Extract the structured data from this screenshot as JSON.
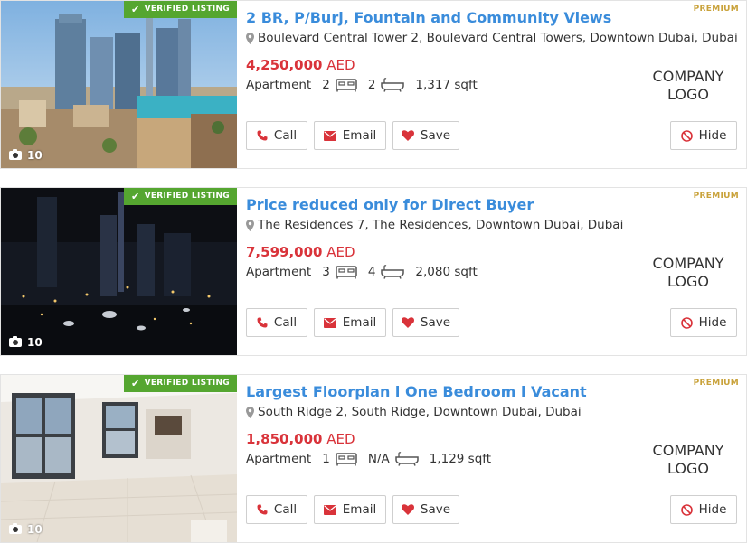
{
  "listings": [
    {
      "verified_label": "VERIFIED LISTING",
      "photo_count": "10",
      "title": "2 BR, P/Burj, Fountain and Community Views",
      "premium_label": "PREMIUM",
      "address": "Boulevard Central Tower 2, Boulevard Central Towers, Downtown Dubai, Dubai",
      "price_amount": "4,250,000",
      "price_currency": "AED",
      "property_type": "Apartment",
      "bedrooms": "2",
      "bathrooms": "2",
      "area": "1,317 sqft",
      "logo_line1": "COMPANY",
      "logo_line2": "LOGO",
      "buttons": {
        "call": "Call",
        "email": "Email",
        "save": "Save",
        "hide": "Hide"
      }
    },
    {
      "verified_label": "VERIFIED LISTING",
      "photo_count": "10",
      "title": "Price reduced only for Direct Buyer",
      "premium_label": "PREMIUM",
      "address": "The Residences 7, The Residences, Downtown Dubai, Dubai",
      "price_amount": "7,599,000",
      "price_currency": "AED",
      "property_type": "Apartment",
      "bedrooms": "3",
      "bathrooms": "4",
      "area": "2,080 sqft",
      "logo_line1": "COMPANY",
      "logo_line2": "LOGO",
      "buttons": {
        "call": "Call",
        "email": "Email",
        "save": "Save",
        "hide": "Hide"
      }
    },
    {
      "verified_label": "VERIFIED LISTING",
      "photo_count": "10",
      "title": "Largest Floorplan l One Bedroom l Vacant",
      "premium_label": "PREMIUM",
      "address": "South Ridge 2, South Ridge, Downtown Dubai, Dubai",
      "price_amount": "1,850,000",
      "price_currency": "AED",
      "property_type": "Apartment",
      "bedrooms": "1",
      "bathrooms": "N/A",
      "area": "1,129 sqft",
      "logo_line1": "COMPANY",
      "logo_line2": "LOGO",
      "buttons": {
        "call": "Call",
        "email": "Email",
        "save": "Save",
        "hide": "Hide"
      }
    }
  ],
  "colors": {
    "title": "#3a8cdb",
    "price": "#d9333a",
    "verified_badge": "#55a630",
    "premium": "#c9a23a",
    "icon_red": "#d9333a"
  },
  "icons": {
    "location": "map-pin-icon",
    "bed": "bed-icon",
    "bath": "bathtub-icon",
    "camera": "camera-icon",
    "call": "phone-icon",
    "email": "envelope-icon",
    "save": "heart-icon",
    "hide": "ban-icon",
    "verified": "check-icon"
  }
}
